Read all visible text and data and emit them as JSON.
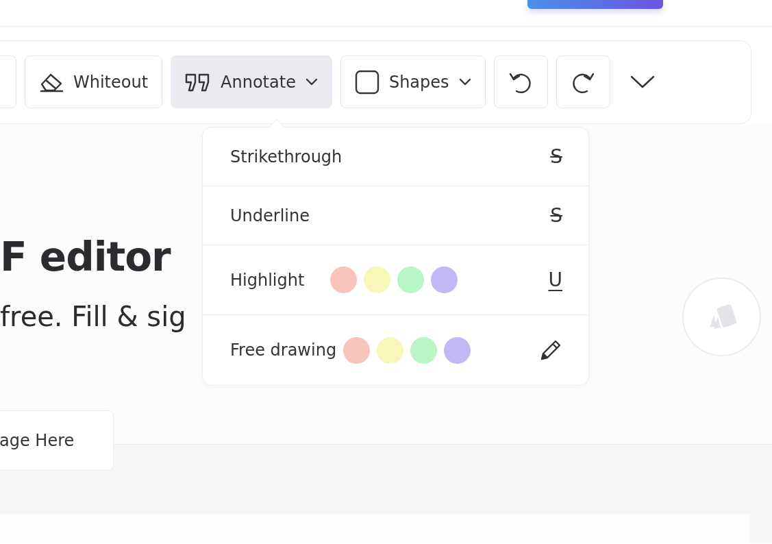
{
  "toolbar": {
    "buttons": [
      {
        "kind": "partial"
      },
      {
        "kind": "eraser",
        "label": "Whiteout",
        "dropdown": false,
        "selected": false
      },
      {
        "kind": "quotes",
        "label": "Annotate",
        "dropdown": true,
        "selected": true
      },
      {
        "kind": "square",
        "label": "Shapes",
        "dropdown": true,
        "selected": false
      },
      {
        "kind": "undo",
        "selected": false
      },
      {
        "kind": "redo",
        "selected": false
      },
      {
        "kind": "more"
      }
    ]
  },
  "hero": {
    "title": "F editor",
    "subtitle": "free. Fill & sig",
    "button": "age Here"
  },
  "annotate_menu": {
    "items": [
      {
        "label": "Strikethrough",
        "kind": "strikethrough",
        "icon_text": "S"
      },
      {
        "label": "Underline",
        "kind": "strikethrough",
        "icon_text": "S"
      },
      {
        "label": "Highlight",
        "kind": "underline",
        "icon_text": "U",
        "colors": [
          {
            "color": "#f8c4bb"
          },
          {
            "color": "#f7f8b8"
          },
          {
            "color": "#b8f6c6"
          },
          {
            "color": "#c1b9f6"
          }
        ]
      },
      {
        "label": "Free drawing",
        "kind": "pencil",
        "colors": [
          {
            "color": "#f8c4bb"
          },
          {
            "color": "#f7f8b8"
          },
          {
            "color": "#b8f6c6"
          },
          {
            "color": "#c1b9f6"
          }
        ]
      }
    ]
  }
}
